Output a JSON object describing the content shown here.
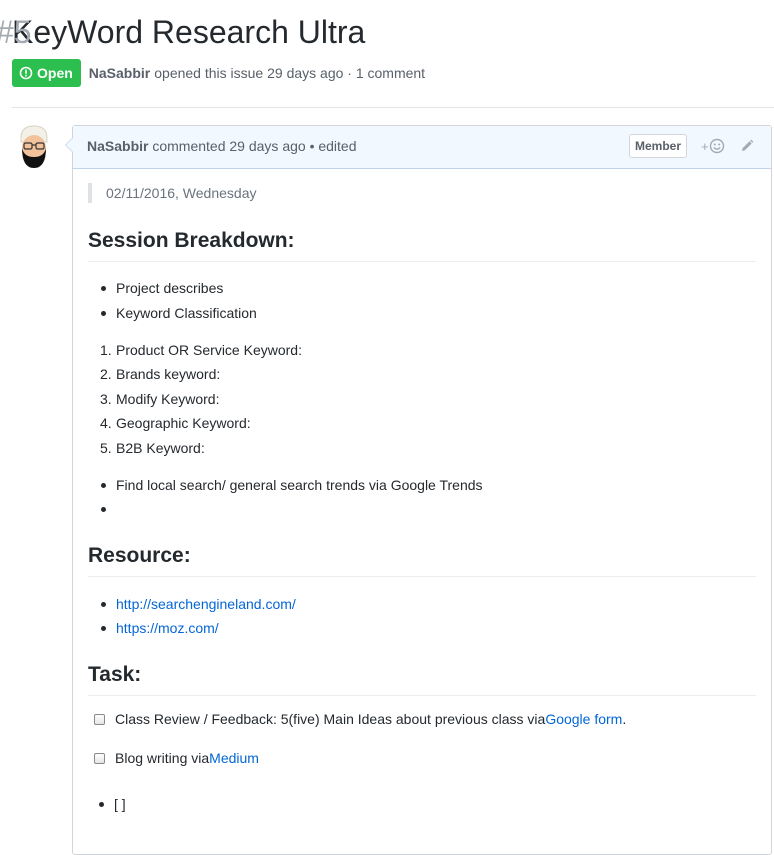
{
  "issue": {
    "title": "KeyWord Research Ultra",
    "number": "#5",
    "state": "Open",
    "author": "NaSabbir",
    "opened_text": "opened this issue 29 days ago · 1 comment"
  },
  "comment": {
    "author": "NaSabbir",
    "meta_text": "commented 29 days ago • edited",
    "role_badge": "Member",
    "reaction_label": "+"
  },
  "body": {
    "quote": "02/11/2016, Wednesday",
    "session": {
      "heading": "Session Breakdown:",
      "bullets": [
        "Project describes",
        "Keyword Classification"
      ],
      "numbered": [
        {
          "n": "1.",
          "text": "Product OR Service Keyword:"
        },
        {
          "n": "2.",
          "text": "Brands keyword:"
        },
        {
          "n": "3.",
          "text": "Modify Keyword:"
        },
        {
          "n": "4.",
          "text": "Geographic Keyword:"
        },
        {
          "n": "5.",
          "text": "B2B Keyword:"
        }
      ],
      "bullets2": [
        "Find local search/ general search trends via Google Trends",
        ""
      ]
    },
    "resource": {
      "heading": "Resource:",
      "links": [
        "http://searchengineland.com/",
        "https://moz.com/"
      ]
    },
    "task": {
      "heading": "Task:",
      "item1_prefix": "Class Review / Feedback: 5(five) Main Ideas about previous class via ",
      "item1_link": "Google form",
      "item1_suffix": ".",
      "item2_prefix": "Blog writing via ",
      "item2_link": "Medium",
      "item3": "[ ]"
    }
  },
  "colors": {
    "open_green": "#2cbe4e",
    "link_blue": "#0366d6",
    "header_bg": "#f1f8ff"
  },
  "icons": [
    "issue-opened-icon",
    "avatar-image",
    "smiley-icon",
    "pencil-icon"
  ]
}
